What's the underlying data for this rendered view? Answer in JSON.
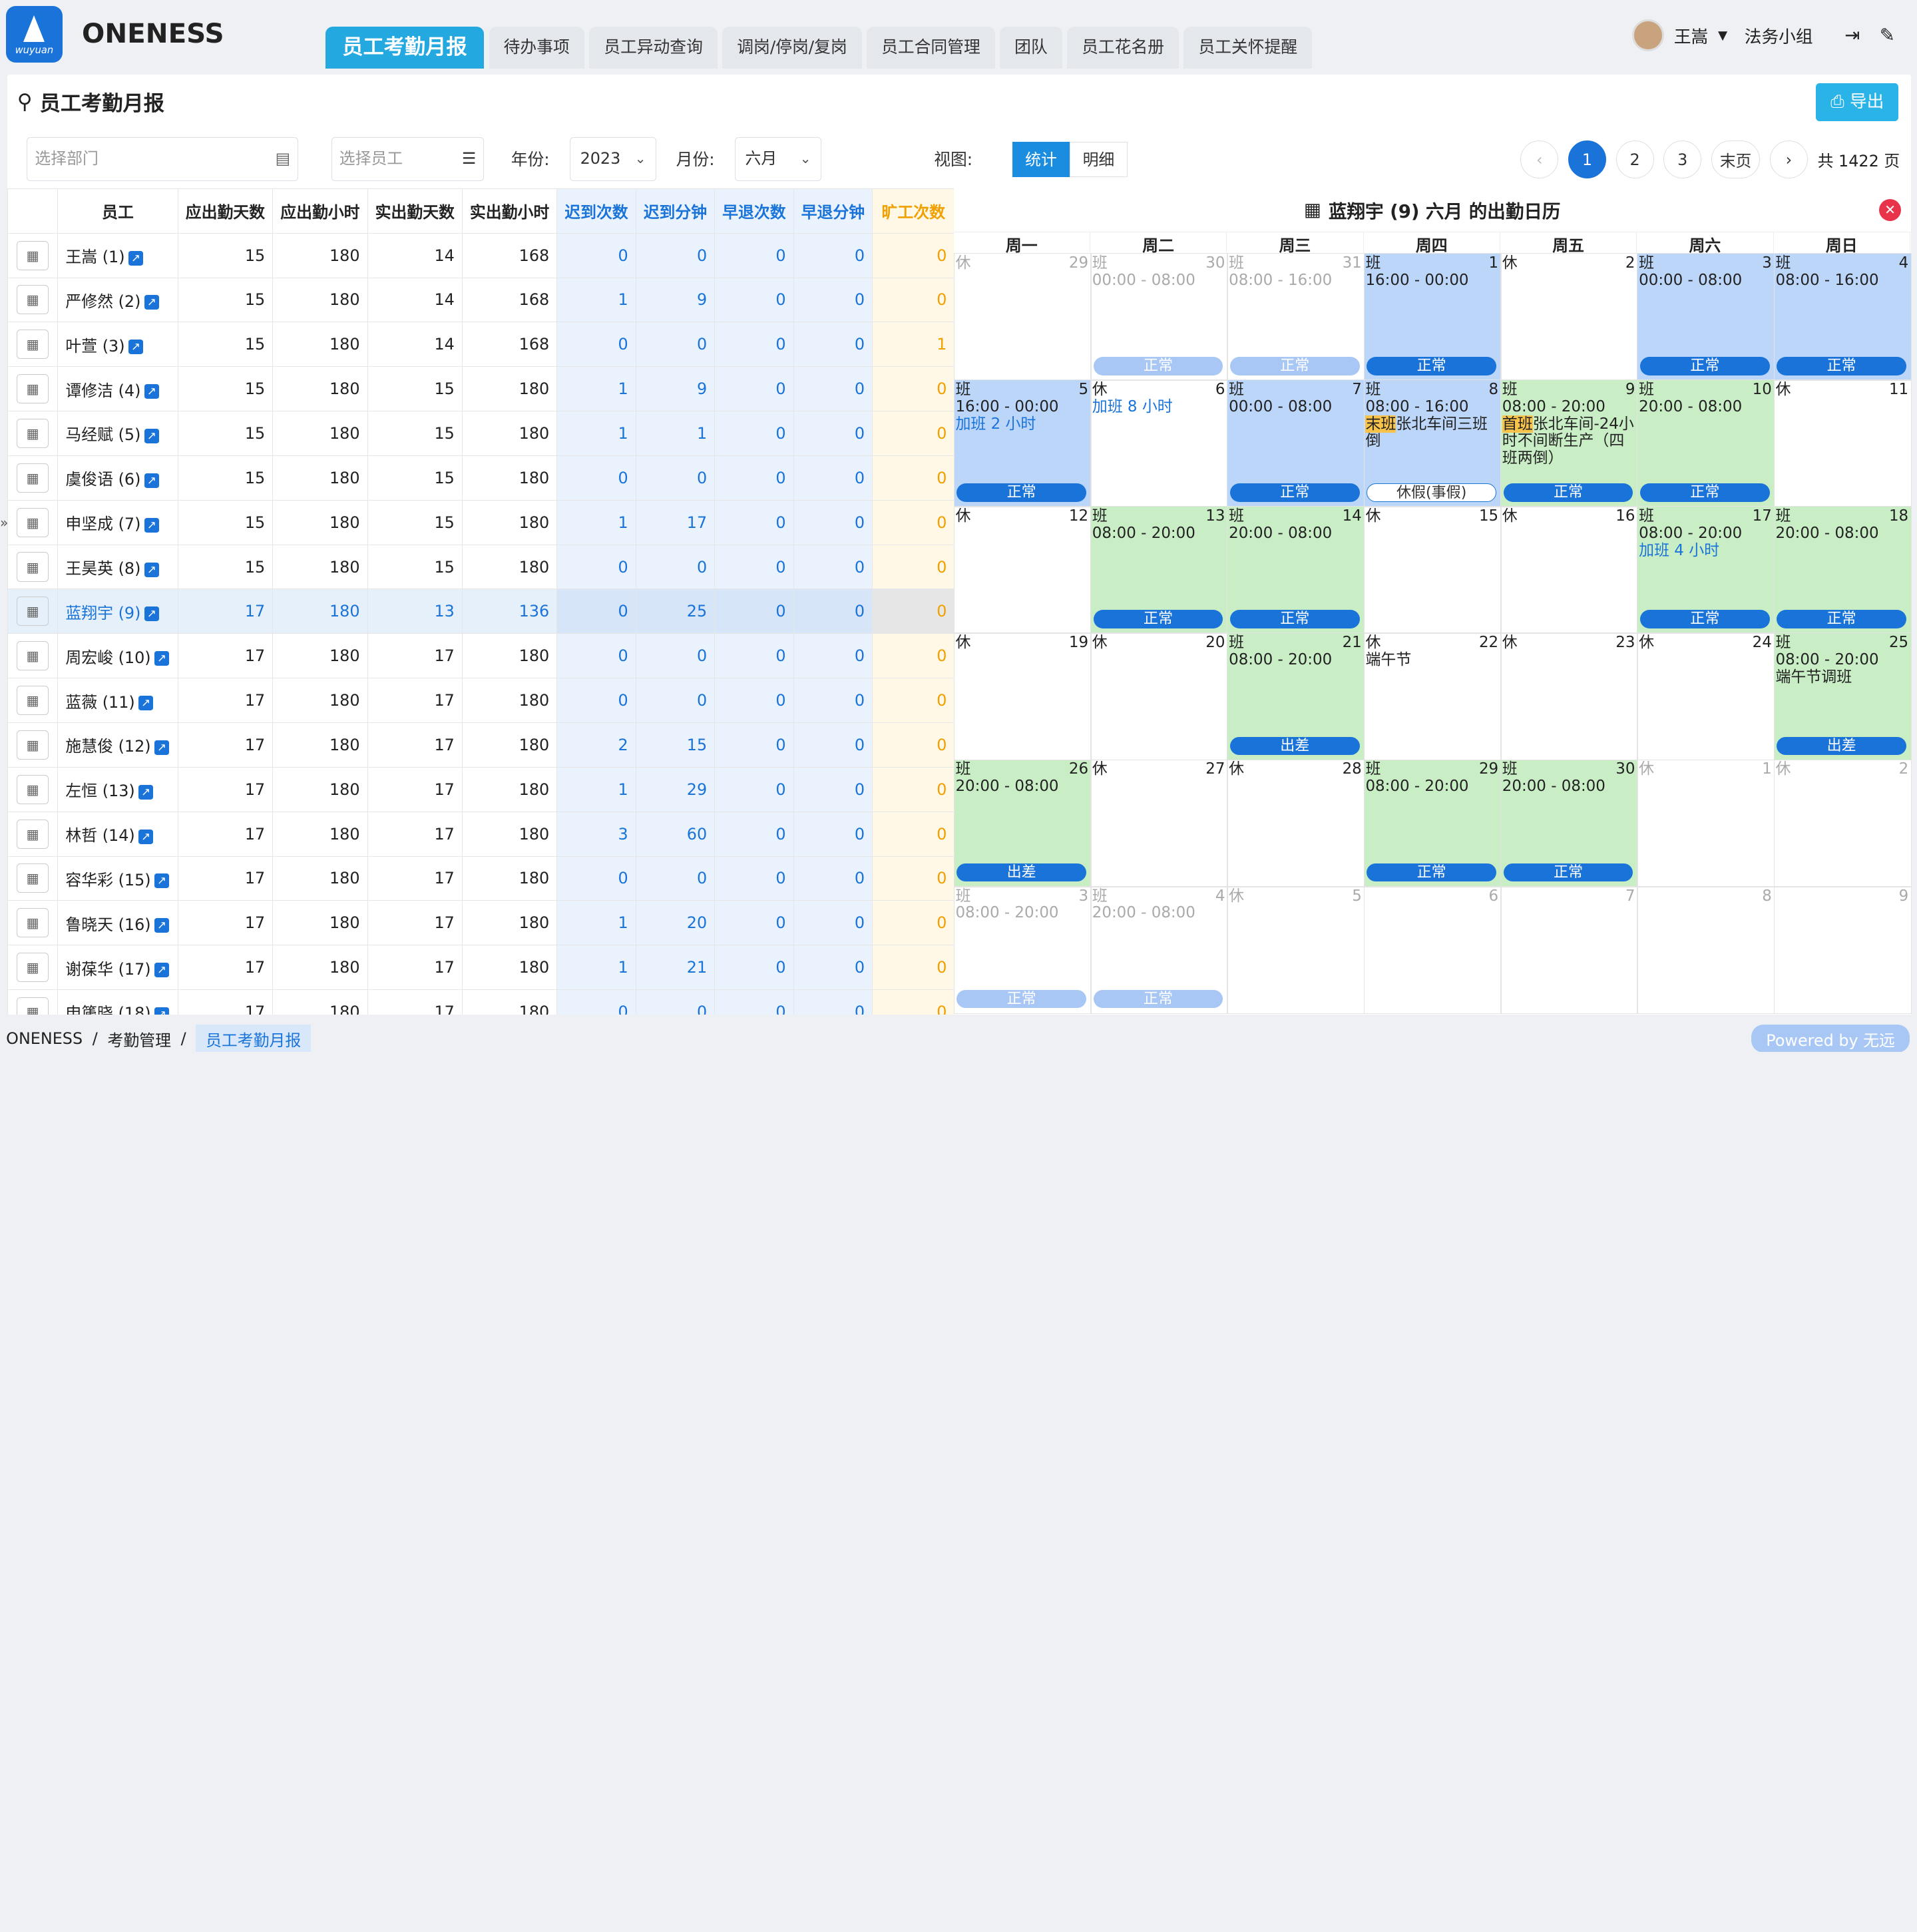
{
  "app": {
    "name": "ONENESS",
    "logo_text": "wuyuan"
  },
  "tabs": [
    "员工考勤月报",
    "待办事项",
    "员工异动查询",
    "调岗/停岗/复岗",
    "员工合同管理",
    "团队",
    "员工花名册",
    "员工关怀提醒"
  ],
  "user": {
    "name": "王嵩",
    "group": "法务小组"
  },
  "page": {
    "title": "员工考勤月报",
    "export": "导出"
  },
  "filters": {
    "dept_placeholder": "选择部门",
    "emp_placeholder": "选择员工",
    "year_label": "年份:",
    "year": "2023",
    "month_label": "月份:",
    "month": "六月",
    "view_label": "视图:",
    "view_stat": "统计",
    "view_detail": "明细"
  },
  "pager": {
    "pages": [
      "1",
      "2",
      "3"
    ],
    "last": "末页",
    "total": "共 1422 页"
  },
  "table": {
    "headers": [
      "员工",
      "应出勤天数",
      "应出勤小时",
      "实出勤天数",
      "实出勤小时",
      "迟到次数",
      "迟到分钟",
      "早退次数",
      "早退分钟",
      "旷工次数"
    ],
    "rows": [
      [
        "王嵩 (1)",
        "15",
        "180",
        "14",
        "168",
        "0",
        "0",
        "0",
        "0",
        "0"
      ],
      [
        "严修然 (2)",
        "15",
        "180",
        "14",
        "168",
        "1",
        "9",
        "0",
        "0",
        "0"
      ],
      [
        "叶萱 (3)",
        "15",
        "180",
        "14",
        "168",
        "0",
        "0",
        "0",
        "0",
        "1"
      ],
      [
        "谭修洁 (4)",
        "15",
        "180",
        "15",
        "180",
        "1",
        "9",
        "0",
        "0",
        "0"
      ],
      [
        "马经赋 (5)",
        "15",
        "180",
        "15",
        "180",
        "1",
        "1",
        "0",
        "0",
        "0"
      ],
      [
        "虞俊语 (6)",
        "15",
        "180",
        "15",
        "180",
        "0",
        "0",
        "0",
        "0",
        "0"
      ],
      [
        "申坚成 (7)",
        "15",
        "180",
        "15",
        "180",
        "1",
        "17",
        "0",
        "0",
        "0"
      ],
      [
        "王昊英 (8)",
        "15",
        "180",
        "15",
        "180",
        "0",
        "0",
        "0",
        "0",
        "0"
      ],
      [
        "蓝翔宇 (9)",
        "17",
        "180",
        "13",
        "136",
        "0",
        "25",
        "0",
        "0",
        "0"
      ],
      [
        "周宏峻 (10)",
        "17",
        "180",
        "17",
        "180",
        "0",
        "0",
        "0",
        "0",
        "0"
      ],
      [
        "蓝薇 (11)",
        "17",
        "180",
        "17",
        "180",
        "0",
        "0",
        "0",
        "0",
        "0"
      ],
      [
        "施慧俊 (12)",
        "17",
        "180",
        "17",
        "180",
        "2",
        "15",
        "0",
        "0",
        "0"
      ],
      [
        "左恒 (13)",
        "17",
        "180",
        "17",
        "180",
        "1",
        "29",
        "0",
        "0",
        "0"
      ],
      [
        "林哲 (14)",
        "17",
        "180",
        "17",
        "180",
        "3",
        "60",
        "0",
        "0",
        "0"
      ],
      [
        "容华彩 (15)",
        "17",
        "180",
        "17",
        "180",
        "0",
        "0",
        "0",
        "0",
        "0"
      ],
      [
        "鲁晓天 (16)",
        "17",
        "180",
        "17",
        "180",
        "1",
        "20",
        "0",
        "0",
        "0"
      ],
      [
        "谢葆华 (17)",
        "17",
        "180",
        "17",
        "180",
        "1",
        "21",
        "0",
        "0",
        "0"
      ],
      [
        "申篪晓 (18)",
        "17",
        "180",
        "17",
        "180",
        "0",
        "0",
        "0",
        "0",
        "0"
      ]
    ]
  },
  "calendar": {
    "title": "蓝翔宇 (9) 六月 的出勤日历",
    "weekdays": [
      "周一",
      "周二",
      "周三",
      "周四",
      "周五",
      "周六",
      "周日"
    ],
    "cells": [
      {
        "k": "休",
        "d": "29",
        "dim": true
      },
      {
        "k": "班",
        "d": "30",
        "t": "00:00 - 08:00",
        "s": "正常",
        "dim": true
      },
      {
        "k": "班",
        "d": "31",
        "t": "08:00 - 16:00",
        "s": "正常",
        "dim": true
      },
      {
        "k": "班",
        "d": "1",
        "t": "16:00 - 00:00",
        "s": "正常",
        "c": "blue"
      },
      {
        "k": "休",
        "d": "2"
      },
      {
        "k": "班",
        "d": "3",
        "t": "00:00 - 08:00",
        "s": "正常",
        "c": "blue"
      },
      {
        "k": "班",
        "d": "4",
        "t": "08:00 - 16:00",
        "s": "正常",
        "c": "blue"
      },
      {
        "k": "班",
        "d": "5",
        "t": "16:00 - 00:00",
        "ot": "加班 2 小时",
        "s": "正常",
        "c": "blue"
      },
      {
        "k": "休",
        "d": "6",
        "ot1": "加班 8 小时"
      },
      {
        "k": "班",
        "d": "7",
        "t": "00:00 - 08:00",
        "s": "正常",
        "c": "blue"
      },
      {
        "k": "班",
        "d": "8",
        "t": "08:00 - 16:00",
        "hl": "末班",
        "ex": "张北车间三班倒",
        "s": "休假(事假)",
        "sw": true,
        "c": "blue"
      },
      {
        "k": "班",
        "d": "9",
        "t": "08:00 - 20:00",
        "hl": "首班",
        "ex": "张北车间-24小时不间断生产（四班两倒）",
        "s": "正常",
        "c": "green"
      },
      {
        "k": "班",
        "d": "10",
        "t": "20:00 - 08:00",
        "s": "正常",
        "c": "green"
      },
      {
        "k": "休",
        "d": "11"
      },
      {
        "k": "休",
        "d": "12"
      },
      {
        "k": "班",
        "d": "13",
        "t": "08:00 - 20:00",
        "s": "正常",
        "c": "green"
      },
      {
        "k": "班",
        "d": "14",
        "t": "20:00 - 08:00",
        "s": "正常",
        "c": "green"
      },
      {
        "k": "休",
        "d": "15"
      },
      {
        "k": "休",
        "d": "16"
      },
      {
        "k": "班",
        "d": "17",
        "t": "08:00 - 20:00",
        "ot": "加班 4 小时",
        "s": "正常",
        "c": "green"
      },
      {
        "k": "班",
        "d": "18",
        "t": "20:00 - 08:00",
        "s": "正常",
        "c": "green"
      },
      {
        "k": "休",
        "d": "19"
      },
      {
        "k": "休",
        "d": "20"
      },
      {
        "k": "班",
        "d": "21",
        "t": "08:00 - 20:00",
        "s": "出差",
        "c": "green"
      },
      {
        "k": "休",
        "d": "22",
        "note": "端午节"
      },
      {
        "k": "休",
        "d": "23"
      },
      {
        "k": "休",
        "d": "24"
      },
      {
        "k": "班",
        "d": "25",
        "t": "08:00 - 20:00",
        "note2": "端午节调班",
        "s": "出差",
        "c": "green"
      },
      {
        "k": "班",
        "d": "26",
        "t": "20:00 - 08:00",
        "s": "出差",
        "c": "green"
      },
      {
        "k": "休",
        "d": "27"
      },
      {
        "k": "休",
        "d": "28"
      },
      {
        "k": "班",
        "d": "29",
        "t": "08:00 - 20:00",
        "s": "正常",
        "c": "green"
      },
      {
        "k": "班",
        "d": "30",
        "t": "20:00 - 08:00",
        "s": "正常",
        "c": "green"
      },
      {
        "k": "休",
        "d": "1",
        "dim": true
      },
      {
        "k": "休",
        "d": "2",
        "dim": true
      },
      {
        "k": "班",
        "d": "3",
        "t": "08:00 - 20:00",
        "s": "正常",
        "dim": true
      },
      {
        "k": "班",
        "d": "4",
        "t": "20:00 - 08:00",
        "s": "正常",
        "dim": true
      },
      {
        "k": "休",
        "d": "5",
        "dim": true
      },
      {
        "k": "",
        "d": "6",
        "dim": true
      },
      {
        "k": "",
        "d": "7",
        "dim": true
      },
      {
        "k": "",
        "d": "8",
        "dim": true
      },
      {
        "k": "",
        "d": "9",
        "dim": true
      }
    ]
  },
  "breadcrumb": [
    "ONENESS",
    "考勤管理",
    "员工考勤月报"
  ],
  "powered": "Powered by 无远"
}
